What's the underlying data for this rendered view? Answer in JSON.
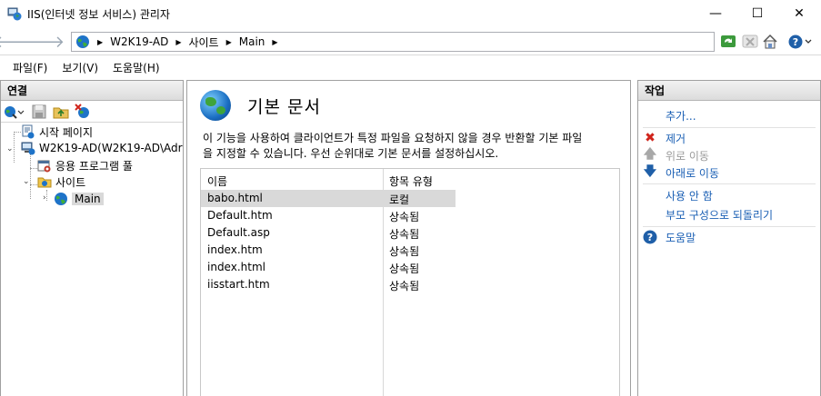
{
  "window": {
    "title": "IIS(인터넷 정보 서비스) 관리자",
    "minimize_glyph": "—",
    "maximize_glyph": "☐",
    "close_glyph": "✕"
  },
  "address": {
    "back_glyph": "🡐",
    "forward_glyph": "🡒",
    "crumbs": [
      "W2K19-AD",
      "사이트",
      "Main"
    ]
  },
  "menu": {
    "items": [
      "파일(F)",
      "보기(V)",
      "도움말(H)"
    ]
  },
  "connections": {
    "header": "연결",
    "tree": [
      {
        "label": "시작 페이지",
        "icon": "start-page-icon"
      },
      {
        "label": "W2K19-AD(W2K19-AD\\Adr",
        "icon": "server-icon"
      },
      {
        "label": "응용 프로그램 풀",
        "icon": "app-pool-icon"
      },
      {
        "label": "사이트",
        "icon": "sites-folder-icon"
      },
      {
        "label": "Main",
        "icon": "globe-icon"
      }
    ]
  },
  "main": {
    "title": "기본 문서",
    "description_line1": "이 기능을 사용하여 클라이언트가 특정 파일을 요청하지 않을 경우 반환할 기본 파일",
    "description_line2": "을 지정할 수 있습니다. 우선 순위대로 기본 문서를 설정하십시오.",
    "columns": [
      "이름",
      "항목 유형"
    ],
    "rows": [
      {
        "name": "babo.html",
        "type": "로컬"
      },
      {
        "name": "Default.htm",
        "type": "상속됨"
      },
      {
        "name": "Default.asp",
        "type": "상속됨"
      },
      {
        "name": "index.htm",
        "type": "상속됨"
      },
      {
        "name": "index.html",
        "type": "상속됨"
      },
      {
        "name": "iisstart.htm",
        "type": "상속됨"
      }
    ],
    "selected_row": 0
  },
  "actions": {
    "header": "작업",
    "add": "추가...",
    "remove": "제거",
    "move_up": "위로 이동",
    "move_down": "아래로 이동",
    "disable": "사용 안 함",
    "revert": "부모 구성으로 되돌리기",
    "help": "도움말"
  },
  "colors": {
    "link": "#1a5fb4",
    "disabled": "#9a9a9a",
    "remove_red": "#d0241b",
    "selection": "#d9d9d9"
  }
}
